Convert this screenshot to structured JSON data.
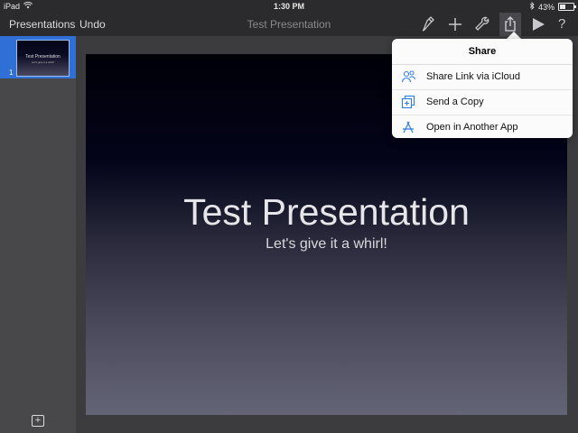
{
  "status_bar": {
    "device": "iPad",
    "time": "1:30 PM",
    "battery": "43%",
    "battery_level": 0.43
  },
  "toolbar": {
    "presentations_label": "Presentations",
    "undo_label": "Undo",
    "document_title": "Test Presentation",
    "icons": [
      "format-brush-icon",
      "add-icon",
      "wrench-icon",
      "share-icon",
      "play-icon",
      "help-icon"
    ],
    "help_label": "?"
  },
  "sidebar": {
    "slides": [
      {
        "number": "1",
        "title": "Test Presentation",
        "subtitle": "Let's give it a whirl!"
      }
    ],
    "add_label": "+"
  },
  "slide": {
    "title": "Test Presentation",
    "subtitle": "Let's give it a whirl!"
  },
  "share_popover": {
    "title": "Share",
    "items": [
      {
        "label": "Share Link via iCloud",
        "icon": "icloud-people-icon"
      },
      {
        "label": "Send a Copy",
        "icon": "send-copy-icon"
      },
      {
        "label": "Open in Another App",
        "icon": "app-store-icon"
      }
    ]
  },
  "colors": {
    "toolbar_bg": "#2b2b2d",
    "accent": "#2f7be9",
    "selection": "#2f6fd6"
  }
}
